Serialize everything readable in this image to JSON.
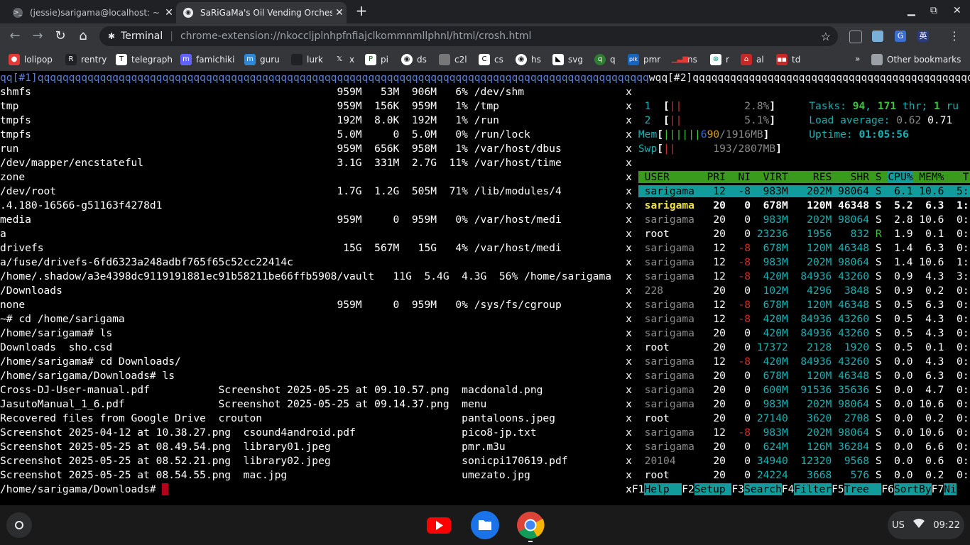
{
  "browser": {
    "tabs": [
      {
        "title": "(jessie)sarigama@localhost: ~",
        "favicon": "terminal-icon",
        "active": false
      },
      {
        "title": "SaRiGaMa's Oil Vending Orchest",
        "favicon": "globe-icon",
        "active": true
      }
    ],
    "omnibox": {
      "site_label": "Terminal",
      "url": "chrome-extension://nkoccljplnhpfnfiajclkommnmllphnl/html/crosh.html"
    },
    "bookmarks": [
      "lolipop",
      "rentry",
      "telegraph",
      "famichiki",
      "guru",
      "lurk",
      "x",
      "pi",
      "ds",
      "c2l",
      "cs",
      "hs",
      "svg",
      "q",
      "pmr",
      "ns",
      "r",
      "al",
      "td"
    ],
    "bookmarks_overflow": "»",
    "other_bookmarks": "Other bookmarks"
  },
  "terminal": {
    "tmux_bar": {
      "left_window": "qq[#1]qqqqqqqqqqqqqqqqqqqqqqqqqqqqqqqqqqqqqqqqqqqqqqqqqqqqqqqqqqqqqqqqqqqqqqqqqqqqqqqqqqqqqqqqqqqqqqqqqq",
      "right_window": "wqq[#2]qqqqqqqqqqqqqqqqqqqqqqqqqqqqqqqqqqqqqqqqqqqqqqqqqqqqqqqqqqqqqqq"
    },
    "left_lines": [
      "shmfs                                                 959M   53M  906M   6% /dev/shm     ",
      "tmp                                                   959M  156K  959M   1% /tmp         ",
      "tmpfs                                                 192M  8.0K  192M   1% /run         ",
      "tmpfs                                                 5.0M     0  5.0M   0% /run/lock    ",
      "run                                                   959M  656K  958M   1% /var/host/dbus",
      "/dev/mapper/encstateful                               3.1G  331M  2.7G  11% /var/host/time",
      "zone",
      "/dev/root                                             1.7G  1.2G  505M  71% /lib/modules/4",
      ".4.180-16566-g51163f4278d1",
      "media                                                 959M     0  959M   0% /var/host/medi",
      "a",
      "drivefs                                                15G  567M   15G   4% /var/host/medi",
      "a/fuse/drivefs-6fd6323a248adbf765f65c52cc22414c",
      "/home/.shadow/a3e4398dc9119191881ec91b58211be66ffb5908/vault   11G  5.4G  4.3G  56% /home/sarigama",
      "/Downloads",
      "none                                                  959M     0  959M   0% /sys/fs/cgroup",
      "~# cd /home/sarigama",
      "/home/sarigama# ls",
      "Downloads  sho.csd",
      "/home/sarigama# cd Downloads/",
      "/home/sarigama/Downloads# ls",
      "Cross-DJ-User-manual.pdf           Screenshot 2025-05-25 at 09.10.57.png  macdonald.png",
      "JasutoManual_1_6.pdf               Screenshot 2025-05-25 at 09.14.37.png  menu",
      "Recovered files from Google Drive  crouton                                pantaloons.jpeg",
      "Screenshot 2025-04-12 at 10.38.27.png  csound4android.pdf                 pico8-jp.txt",
      "Screenshot 2025-05-25 at 08.49.54.png  library01.jpeg                     pmr.m3u",
      "Screenshot 2025-05-25 at 08.52.21.png  library02.jpeg                     sonicpi170619.pdf",
      "Screenshot 2025-05-25 at 08.54.55.png  mac.jpg                            umezato.jpg"
    ],
    "prompt": "/home/sarigama/Downloads# ",
    "separator_char": "x",
    "htop": {
      "cpus": [
        {
          "id": "1",
          "bar": "||",
          "percent": "2.8%"
        },
        {
          "id": "2",
          "bar": "||",
          "percent": "5.1%"
        }
      ],
      "mem": {
        "label": "Mem",
        "bar": "||||||6",
        "value": "90/1916MB"
      },
      "swp": {
        "label": "Swp",
        "bar": "||",
        "value": "193/2807MB"
      },
      "tasks_label": "Tasks:",
      "tasks": "94",
      "threads": "171",
      "thr_label": "thr;",
      "running": "1",
      "running_label": "ru",
      "load_label": "Load average:",
      "load1": "0.62",
      "load5": "0.71",
      "uptime_label": "Uptime:",
      "uptime": "01:05:56",
      "columns": [
        "USER",
        "PRI",
        "NI",
        "VIRT",
        "RES",
        "SHR",
        "S",
        "CPU%",
        "MEM%",
        "T"
      ],
      "rows": [
        {
          "user": "sarigama",
          "pri": "12",
          "ni": "-8",
          "virt": "983M",
          "res": "202M",
          "shr": "98064",
          "s": "S",
          "cpu": "6.1",
          "mem": "10.6",
          "t": "5:"
        },
        {
          "user": "sarigama",
          "pri": "20",
          "ni": "0",
          "virt": "678M",
          "res": "120M",
          "shr": "46348",
          "s": "S",
          "cpu": "5.2",
          "mem": "6.3",
          "t": "1:"
        },
        {
          "user": "sarigama",
          "pri": "20",
          "ni": "0",
          "virt": "983M",
          "res": "202M",
          "shr": "98064",
          "s": "S",
          "cpu": "2.8",
          "mem": "10.6",
          "t": "0:"
        },
        {
          "user": "root",
          "pri": "20",
          "ni": "0",
          "virt": "23236",
          "res": "1956",
          "shr": "832",
          "s": "R",
          "cpu": "1.9",
          "mem": "0.1",
          "t": "0:"
        },
        {
          "user": "sarigama",
          "pri": "12",
          "ni": "-8",
          "virt": "678M",
          "res": "120M",
          "shr": "46348",
          "s": "S",
          "cpu": "1.4",
          "mem": "6.3",
          "t": "0:"
        },
        {
          "user": "sarigama",
          "pri": "12",
          "ni": "-8",
          "virt": "983M",
          "res": "202M",
          "shr": "98064",
          "s": "S",
          "cpu": "1.4",
          "mem": "10.6",
          "t": "1:"
        },
        {
          "user": "sarigama",
          "pri": "12",
          "ni": "-8",
          "virt": "420M",
          "res": "84936",
          "shr": "43260",
          "s": "S",
          "cpu": "0.9",
          "mem": "4.3",
          "t": "3:"
        },
        {
          "user": "228",
          "pri": "20",
          "ni": "0",
          "virt": "102M",
          "res": "4296",
          "shr": "3848",
          "s": "S",
          "cpu": "0.9",
          "mem": "0.2",
          "t": "0:"
        },
        {
          "user": "sarigama",
          "pri": "12",
          "ni": "-8",
          "virt": "678M",
          "res": "120M",
          "shr": "46348",
          "s": "S",
          "cpu": "0.5",
          "mem": "6.3",
          "t": "0:"
        },
        {
          "user": "sarigama",
          "pri": "12",
          "ni": "-8",
          "virt": "420M",
          "res": "84936",
          "shr": "43260",
          "s": "S",
          "cpu": "0.5",
          "mem": "4.3",
          "t": "0:"
        },
        {
          "user": "sarigama",
          "pri": "20",
          "ni": "0",
          "virt": "420M",
          "res": "84936",
          "shr": "43260",
          "s": "S",
          "cpu": "0.5",
          "mem": "4.3",
          "t": "0:"
        },
        {
          "user": "root",
          "pri": "20",
          "ni": "0",
          "virt": "17372",
          "res": "2128",
          "shr": "1920",
          "s": "S",
          "cpu": "0.5",
          "mem": "0.1",
          "t": "0:"
        },
        {
          "user": "sarigama",
          "pri": "12",
          "ni": "-8",
          "virt": "420M",
          "res": "84936",
          "shr": "43260",
          "s": "S",
          "cpu": "0.0",
          "mem": "4.3",
          "t": "0:"
        },
        {
          "user": "sarigama",
          "pri": "20",
          "ni": "0",
          "virt": "678M",
          "res": "120M",
          "shr": "46348",
          "s": "S",
          "cpu": "0.0",
          "mem": "6.3",
          "t": "0:"
        },
        {
          "user": "sarigama",
          "pri": "20",
          "ni": "0",
          "virt": "600M",
          "res": "91536",
          "shr": "35636",
          "s": "S",
          "cpu": "0.0",
          "mem": "4.7",
          "t": "0:"
        },
        {
          "user": "sarigama",
          "pri": "20",
          "ni": "0",
          "virt": "983M",
          "res": "202M",
          "shr": "98064",
          "s": "S",
          "cpu": "0.0",
          "mem": "10.6",
          "t": "0:"
        },
        {
          "user": "root",
          "pri": "20",
          "ni": "0",
          "virt": "27140",
          "res": "3620",
          "shr": "2708",
          "s": "S",
          "cpu": "0.0",
          "mem": "0.2",
          "t": "0:"
        },
        {
          "user": "sarigama",
          "pri": "12",
          "ni": "-8",
          "virt": "983M",
          "res": "202M",
          "shr": "98064",
          "s": "S",
          "cpu": "0.0",
          "mem": "10.6",
          "t": "0:"
        },
        {
          "user": "sarigama",
          "pri": "20",
          "ni": "0",
          "virt": "624M",
          "res": "126M",
          "shr": "36284",
          "s": "S",
          "cpu": "0.0",
          "mem": "6.6",
          "t": "0:"
        },
        {
          "user": "20104",
          "pri": "20",
          "ni": "0",
          "virt": "34940",
          "res": "12320",
          "shr": "9568",
          "s": "S",
          "cpu": "0.0",
          "mem": "0.6",
          "t": "0:"
        },
        {
          "user": "root",
          "pri": "20",
          "ni": "0",
          "virt": "24224",
          "res": "3668",
          "shr": "576",
          "s": "S",
          "cpu": "0.0",
          "mem": "0.2",
          "t": "0:"
        }
      ],
      "fkeys": [
        {
          "key": "F1",
          "label": "Help  "
        },
        {
          "key": "F2",
          "label": "Setup "
        },
        {
          "key": "F3",
          "label": "Search"
        },
        {
          "key": "F4",
          "label": "Filter"
        },
        {
          "key": "F5",
          "label": "Tree  "
        },
        {
          "key": "F6",
          "label": "SortBy"
        },
        {
          "key": "F7",
          "label": "Ni"
        }
      ]
    }
  },
  "shelf": {
    "ime": "US",
    "clock": "09:22"
  },
  "colors": {
    "tmux_bar": "#5c7fd6",
    "htop_header_bg": "#3a9a1e",
    "selected_row_bg": "#129b9b",
    "fkey_bg": "#129b9b",
    "cyan": "#1bb0b0",
    "green": "#3ec33e",
    "red": "#cc2e2e",
    "gray": "#8a8a8a"
  }
}
